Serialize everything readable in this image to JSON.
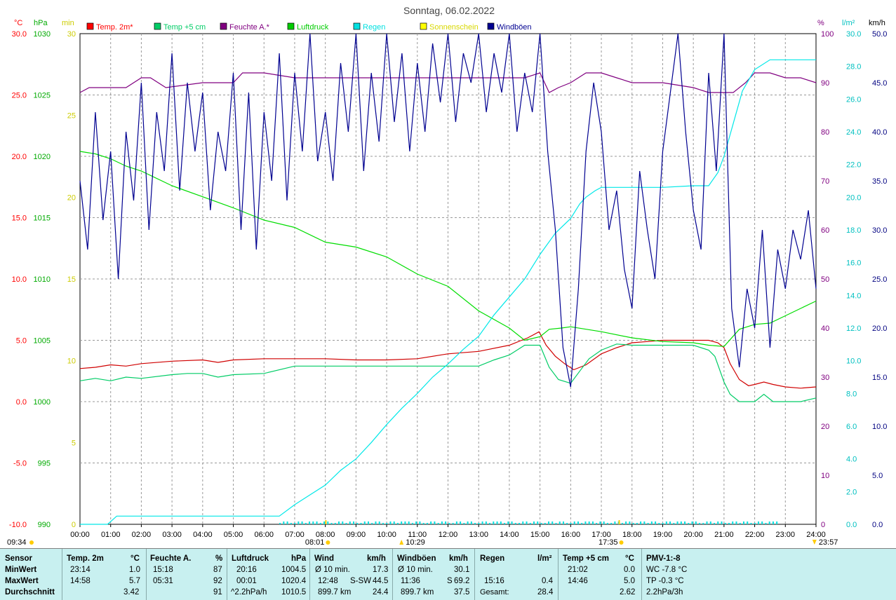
{
  "chart_data": {
    "type": "line",
    "title": "Sonntag, 06.02.2022",
    "x_ticks": [
      "00:00",
      "01:00",
      "02:00",
      "03:00",
      "04:00",
      "05:00",
      "06:00",
      "07:00",
      "08:00",
      "09:00",
      "10:00",
      "11:00",
      "12:00",
      "13:00",
      "14:00",
      "15:00",
      "16:00",
      "17:00",
      "18:00",
      "19:00",
      "20:00",
      "21:00",
      "22:00",
      "23:00",
      "24:00"
    ],
    "xlim": [
      0,
      24
    ],
    "grid": true,
    "axes": {
      "temp": {
        "unit": "°C",
        "color": "#ff0000",
        "ticks": [
          "30.0",
          "25.0",
          "20.0",
          "15.0",
          "10.0",
          "5.0",
          "0.0",
          "-5.0",
          "-10.0"
        ],
        "ylim": [
          -10,
          30
        ]
      },
      "pressure": {
        "unit": "hPa",
        "color": "#00aa00",
        "ticks": [
          "1030",
          "1025",
          "1020",
          "1015",
          "1010",
          "1005",
          "1000",
          "995",
          "990"
        ],
        "ylim": [
          990,
          1030
        ]
      },
      "sunshine": {
        "unit": "min",
        "color": "#cccc00",
        "ticks": [
          "30",
          "25",
          "20",
          "15",
          "10",
          "5",
          "0"
        ],
        "ylim": [
          0,
          30
        ]
      },
      "humidity": {
        "unit": "%",
        "color": "#800080",
        "ticks": [
          "100",
          "90",
          "80",
          "70",
          "60",
          "50",
          "40",
          "30",
          "20",
          "10",
          "0"
        ],
        "ylim": [
          0,
          100
        ]
      },
      "rain": {
        "unit": "l/m²",
        "color": "#00c0c0",
        "ticks": [
          "30.0",
          "28.0",
          "26.0",
          "24.0",
          "22.0",
          "20.0",
          "18.0",
          "16.0",
          "14.0",
          "12.0",
          "10.0",
          "8.0",
          "6.0",
          "4.0",
          "2.0",
          "0.0"
        ],
        "ylim": [
          0,
          30
        ]
      },
      "wind": {
        "unit": "km/h",
        "color": "#000080",
        "ticks": [
          "50.0",
          "45.0",
          "40.0",
          "35.0",
          "30.0",
          "25.0",
          "20.0",
          "15.0",
          "10.0",
          "5.0",
          "0.0"
        ],
        "ylim": [
          0,
          50
        ]
      }
    },
    "legend": [
      {
        "label": "Temp. 2m*",
        "color": "#ff0000"
      },
      {
        "label": "Temp +5 cm",
        "color": "#00cc66"
      },
      {
        "label": "Feuchte A.*",
        "color": "#800080"
      },
      {
        "label": "Luftdruck",
        "color": "#00cc00"
      },
      {
        "label": "Regen",
        "color": "#00e0e0"
      },
      {
        "label": "Sonnenschein",
        "color": "#ffff00"
      },
      {
        "label": "Windböen",
        "color": "#000090"
      }
    ],
    "series": [
      {
        "name": "Temp. 2m*",
        "axis": "temp",
        "color": "#d00000",
        "x": [
          0,
          0.5,
          1,
          1.5,
          2,
          3,
          4,
          4.5,
          5,
          6,
          7,
          8,
          9,
          10,
          11,
          12,
          13,
          14,
          14.6,
          14.97,
          15.2,
          15.5,
          15.8,
          16.1,
          16.5,
          17,
          17.5,
          18,
          18.5,
          19,
          19.5,
          20,
          20.5,
          20.8,
          21,
          21.2,
          21.5,
          21.8,
          22,
          22.3,
          22.6,
          23,
          23.5,
          24
        ],
        "y": [
          2.7,
          2.8,
          3.0,
          2.9,
          3.1,
          3.3,
          3.4,
          3.2,
          3.4,
          3.5,
          3.5,
          3.5,
          3.4,
          3.4,
          3.5,
          3.9,
          4.1,
          4.6,
          5.2,
          5.7,
          4.6,
          3.7,
          3.1,
          2.6,
          3.0,
          3.9,
          4.4,
          4.8,
          4.9,
          5.0,
          5.0,
          5.0,
          5.0,
          4.8,
          4.4,
          3.1,
          1.8,
          1.3,
          1.4,
          1.6,
          1.4,
          1.2,
          1.1,
          1.2
        ]
      },
      {
        "name": "Temp +5 cm",
        "axis": "temp",
        "color": "#00cc66",
        "x": [
          0,
          0.5,
          1,
          1.5,
          2,
          3,
          3.5,
          4,
          4.5,
          5,
          6,
          7,
          8,
          9,
          10,
          11,
          12,
          13,
          13.5,
          14,
          14.5,
          15,
          15.3,
          15.6,
          16,
          16.3,
          16.6,
          17,
          17.5,
          18,
          18.5,
          19,
          20,
          20.5,
          20.7,
          21,
          21.2,
          21.5,
          22,
          22.3,
          22.6,
          23,
          23.5,
          24
        ],
        "y": [
          1.7,
          1.9,
          1.7,
          2.0,
          1.9,
          2.2,
          2.3,
          2.3,
          2.0,
          2.2,
          2.3,
          2.9,
          2.9,
          2.9,
          2.9,
          2.9,
          2.9,
          2.9,
          3.4,
          3.8,
          4.6,
          4.6,
          2.8,
          1.8,
          1.5,
          2.5,
          3.5,
          4.2,
          4.7,
          4.6,
          4.6,
          4.6,
          4.6,
          4.2,
          3.7,
          1.6,
          0.6,
          0.0,
          0.0,
          0.6,
          0.0,
          0.0,
          0.0,
          0.3
        ]
      },
      {
        "name": "Feuchte A.*",
        "axis": "humidity",
        "color": "#800080",
        "x": [
          0,
          0.3,
          1,
          1.5,
          2,
          2.3,
          2.8,
          4,
          5,
          5.3,
          6,
          7,
          8,
          9,
          10,
          11,
          12,
          13,
          14,
          14.5,
          15,
          15.3,
          15.6,
          16,
          16.5,
          17,
          17.5,
          18,
          18.5,
          19,
          20,
          20.5,
          21,
          21.3,
          21.7,
          22,
          22.5,
          23,
          23.5,
          24
        ],
        "y": [
          88,
          89,
          89,
          89,
          91,
          91,
          89,
          90,
          90,
          92,
          92,
          91,
          91,
          91,
          91,
          91,
          91,
          91,
          91,
          91,
          92,
          88,
          89,
          90,
          92,
          92,
          91,
          90,
          90,
          90,
          89,
          88,
          88,
          88,
          90,
          92,
          92,
          91,
          91,
          90
        ]
      },
      {
        "name": "Luftdruck",
        "axis": "pressure",
        "color": "#00dd00",
        "x": [
          0,
          0.5,
          1,
          1.5,
          2,
          3,
          4,
          5,
          6,
          7,
          8,
          9,
          10,
          11,
          12,
          13,
          14,
          14.5,
          15,
          15.3,
          15.7,
          16,
          17,
          18,
          19,
          20,
          20.5,
          21,
          21.5,
          22,
          22.5,
          23,
          23.5,
          24
        ],
        "y": [
          1020.4,
          1020.2,
          1019.8,
          1019.2,
          1018.8,
          1017.6,
          1016.7,
          1015.8,
          1014.8,
          1014.2,
          1013.0,
          1012.6,
          1011.8,
          1010.4,
          1009.4,
          1007.4,
          1006.0,
          1005.0,
          1005.3,
          1005.9,
          1006.0,
          1006.1,
          1005.7,
          1005.2,
          1004.9,
          1004.8,
          1004.6,
          1004.5,
          1005.9,
          1006.3,
          1006.4,
          1007.0,
          1007.6,
          1008.2
        ]
      },
      {
        "name": "Regen",
        "axis": "rain",
        "color": "#00e8e8",
        "x": [
          0,
          0.9,
          1.2,
          6.5,
          7,
          7.5,
          8,
          8.5,
          9,
          9.5,
          10,
          10.5,
          11,
          11.5,
          12,
          12.5,
          13,
          13.5,
          14,
          14.5,
          15,
          15.5,
          16,
          16.3,
          16.5,
          16.8,
          17,
          17.5,
          18,
          19,
          20,
          20.5,
          20.8,
          21,
          21.3,
          21.6,
          22,
          22.5,
          23,
          24
        ],
        "y": [
          0,
          0,
          0.5,
          0.5,
          1.2,
          1.8,
          2.4,
          3.3,
          4.0,
          5.0,
          6.1,
          7.1,
          8.0,
          9.0,
          9.8,
          10.7,
          11.5,
          12.8,
          13.9,
          15.0,
          16.5,
          17.8,
          18.7,
          19.6,
          20.0,
          20.4,
          20.6,
          20.6,
          20.6,
          20.6,
          20.7,
          20.7,
          21.5,
          22.5,
          24.5,
          26.5,
          27.8,
          28.4,
          28.4,
          28.4
        ]
      },
      {
        "name": "Windböen",
        "axis": "wind",
        "color": "#000090",
        "x": [
          0,
          0.25,
          0.5,
          0.75,
          1,
          1.25,
          1.5,
          1.75,
          2,
          2.25,
          2.5,
          2.75,
          3,
          3.25,
          3.5,
          3.75,
          4,
          4.25,
          4.5,
          4.75,
          5,
          5.25,
          5.5,
          5.75,
          6,
          6.25,
          6.5,
          6.75,
          7,
          7.25,
          7.5,
          7.75,
          8,
          8.25,
          8.5,
          8.75,
          9,
          9.25,
          9.5,
          9.75,
          10,
          10.25,
          10.5,
          10.75,
          11,
          11.25,
          11.5,
          11.75,
          12,
          12.25,
          12.5,
          12.75,
          13,
          13.25,
          13.5,
          13.75,
          14,
          14.25,
          14.5,
          14.75,
          15,
          15.25,
          15.5,
          15.75,
          16,
          16.25,
          16.5,
          16.75,
          17,
          17.25,
          17.5,
          17.75,
          18,
          18.25,
          18.5,
          18.75,
          19,
          19.25,
          19.5,
          19.75,
          20,
          20.25,
          20.5,
          20.75,
          21,
          21.25,
          21.5,
          21.75,
          22,
          22.25,
          22.5,
          22.75,
          23,
          23.25,
          23.5,
          23.75,
          24
        ],
        "y": [
          35,
          28,
          42,
          31,
          38,
          25,
          40,
          33,
          45,
          30,
          42,
          36,
          48,
          34,
          45,
          38,
          44,
          32,
          40,
          36,
          46,
          30,
          44,
          28,
          42,
          35,
          48,
          33,
          46,
          38,
          50,
          37,
          42,
          35,
          47,
          40,
          50,
          36,
          46,
          39,
          50,
          41,
          48,
          38,
          47,
          40,
          49,
          43,
          50,
          41,
          48,
          45,
          50,
          42,
          48,
          44,
          50,
          40,
          46,
          42,
          50,
          38,
          30,
          18,
          14,
          24,
          38,
          45,
          40,
          30,
          34,
          26,
          22,
          36,
          30,
          25,
          38,
          44,
          50,
          40,
          32,
          28,
          46,
          36,
          50,
          22,
          16,
          24,
          20,
          30,
          18,
          28,
          24,
          30,
          27,
          32,
          24
        ]
      }
    ],
    "markers": {
      "left_time": "09:34",
      "sunrise": "08:01",
      "noon": "10:29",
      "sunset": "17:35",
      "end": "23:57"
    }
  },
  "footer": {
    "row_labels": {
      "sensor": "Sensor",
      "min": "MinWert",
      "max": "MaxWert",
      "avg": "Durchschnitt"
    },
    "temp2m": {
      "title": "Temp. 2m",
      "unit": "°C",
      "min_time": "23:14",
      "min_val": "1.0",
      "max_time": "14:58",
      "max_val": "5.7",
      "avg": "3.42"
    },
    "humidity": {
      "title": "Feuchte A.",
      "unit": "%",
      "min_time": "15:18",
      "min_val": "87",
      "max_time": "05:31",
      "max_val": "92",
      "avg": "91"
    },
    "pressure": {
      "title": "Luftdruck",
      "unit": "hPa",
      "min_time": "20:16",
      "min_val": "1004.5",
      "max_time": "00:01",
      "max_val": "1020.4",
      "trend": "^2.2hPa/h",
      "avg": "1010.5"
    },
    "wind": {
      "title": "Wind",
      "unit": "km/h",
      "min_label": "Ø 10 min.",
      "min_val": "17.3",
      "max_time": "12:48",
      "max_dir": "S-SW",
      "max_val": "44.5",
      "km": "899.7 km",
      "avg": "24.4"
    },
    "gust": {
      "title": "Windböen",
      "unit": "km/h",
      "min_label": "Ø 10 min.",
      "min_val": "30.1",
      "max_time": "11:36",
      "max_dir": "S",
      "max_val": "69.2",
      "km": "899.7 km",
      "avg": "37.5"
    },
    "rain": {
      "title": "Regen",
      "unit": "l/m²",
      "max_time": "15:16",
      "max_val": "0.4",
      "total_label": "Gesamt:",
      "total": "28.4"
    },
    "temp5": {
      "title": "Temp +5 cm",
      "unit": "°C",
      "min_time": "21:02",
      "min_val": "0.0",
      "max_time": "14:46",
      "max_val": "5.0",
      "avg": "2.62"
    },
    "pmv": {
      "title": "PMV-1:-8",
      "wc": "WC -7.8 °C",
      "tp": "TP -0.3 °C",
      "trend": "2.2hPa/3h"
    }
  }
}
